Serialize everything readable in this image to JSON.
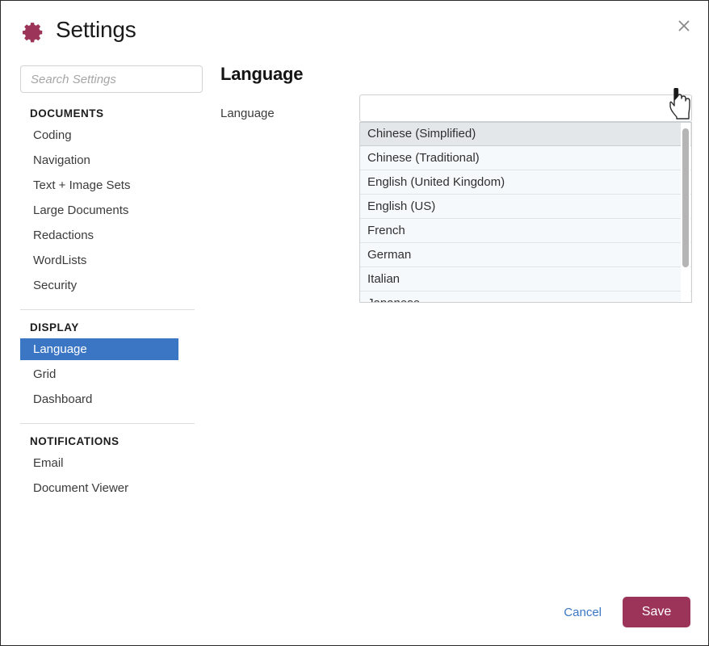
{
  "window": {
    "title": "Settings",
    "gear_icon": "gear-icon",
    "close_icon": "close-icon"
  },
  "search": {
    "placeholder": "Search Settings",
    "value": ""
  },
  "sidebar": {
    "sections": [
      {
        "heading": "DOCUMENTS",
        "items": [
          {
            "label": "Coding",
            "selected": false
          },
          {
            "label": "Navigation",
            "selected": false
          },
          {
            "label": "Text + Image Sets",
            "selected": false
          },
          {
            "label": "Large Documents",
            "selected": false
          },
          {
            "label": "Redactions",
            "selected": false
          },
          {
            "label": "WordLists",
            "selected": false
          },
          {
            "label": "Security",
            "selected": false
          }
        ]
      },
      {
        "heading": "DISPLAY",
        "items": [
          {
            "label": "Language",
            "selected": true
          },
          {
            "label": "Grid",
            "selected": false
          },
          {
            "label": "Dashboard",
            "selected": false
          }
        ]
      },
      {
        "heading": "NOTIFICATIONS",
        "items": [
          {
            "label": "Email",
            "selected": false
          },
          {
            "label": "Document Viewer",
            "selected": false
          }
        ]
      }
    ]
  },
  "main": {
    "panel_title": "Language",
    "field_label": "Language",
    "select": {
      "value": "",
      "arrow_icon": "chevron-down-icon",
      "expanded": true,
      "options": [
        "Chinese (Simplified)",
        "Chinese (Traditional)",
        "English (United Kingdom)",
        "English (US)",
        "French",
        "German",
        "Italian",
        "Japanese"
      ],
      "highlighted_option": "Chinese (Simplified)"
    }
  },
  "footer": {
    "cancel_label": "Cancel",
    "save_label": "Save"
  },
  "cursor": {
    "icon": "pointing-hand-cursor"
  },
  "colors": {
    "accent_maroon": "#9c3459",
    "selection_blue": "#3a76c4",
    "link_blue": "#3a76c4",
    "list_background": "#f6f9fb",
    "highlight_gray": "#e4e7ea"
  }
}
